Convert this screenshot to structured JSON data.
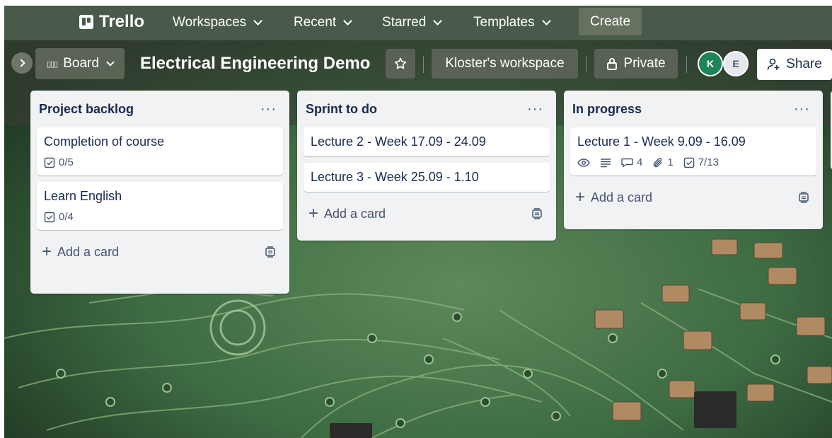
{
  "nav": {
    "logo": "Trello",
    "items": [
      "Workspaces",
      "Recent",
      "Starred",
      "Templates"
    ],
    "create": "Create"
  },
  "board": {
    "view_label": "Board",
    "title": "Electrical Engineering Demo",
    "workspace": "Kloster's workspace",
    "visibility": "Private",
    "members": [
      "K",
      "E"
    ],
    "share": "Share"
  },
  "lists": [
    {
      "title": "Project backlog",
      "menu": "···",
      "cards": [
        {
          "title": "Completion of course",
          "checklist": "0/5"
        },
        {
          "title": "Learn English",
          "checklist": "0/4"
        }
      ],
      "add_card": "Add a card"
    },
    {
      "title": "Sprint to do",
      "menu": "···",
      "cards": [
        {
          "title": "Lecture 2 - Week 17.09 - 24.09"
        },
        {
          "title": "Lecture 3 - Week 25.09 - 1.10"
        }
      ],
      "add_card": "Add a card"
    },
    {
      "title": "In progress",
      "menu": "···",
      "cards": [
        {
          "title": "Lecture 1 - Week 9.09 - 16.09",
          "comments": "4",
          "attachments": "1",
          "checklist": "7/13"
        }
      ],
      "add_card": "Add a card"
    }
  ],
  "icons": {
    "star": "star-icon",
    "lock": "lock-icon",
    "share": "add-person-icon",
    "template": "card-template-icon",
    "watch": "eye-icon",
    "description": "description-icon",
    "comment": "comment-icon",
    "attachment": "paperclip-icon",
    "checklist": "checkbox-icon"
  },
  "colors": {
    "nav_bg": "#4a5a4a",
    "list_bg": "#f1f2f4",
    "card_bg": "#ffffff",
    "text": "#172b4d",
    "member_k": "#1f845a"
  }
}
